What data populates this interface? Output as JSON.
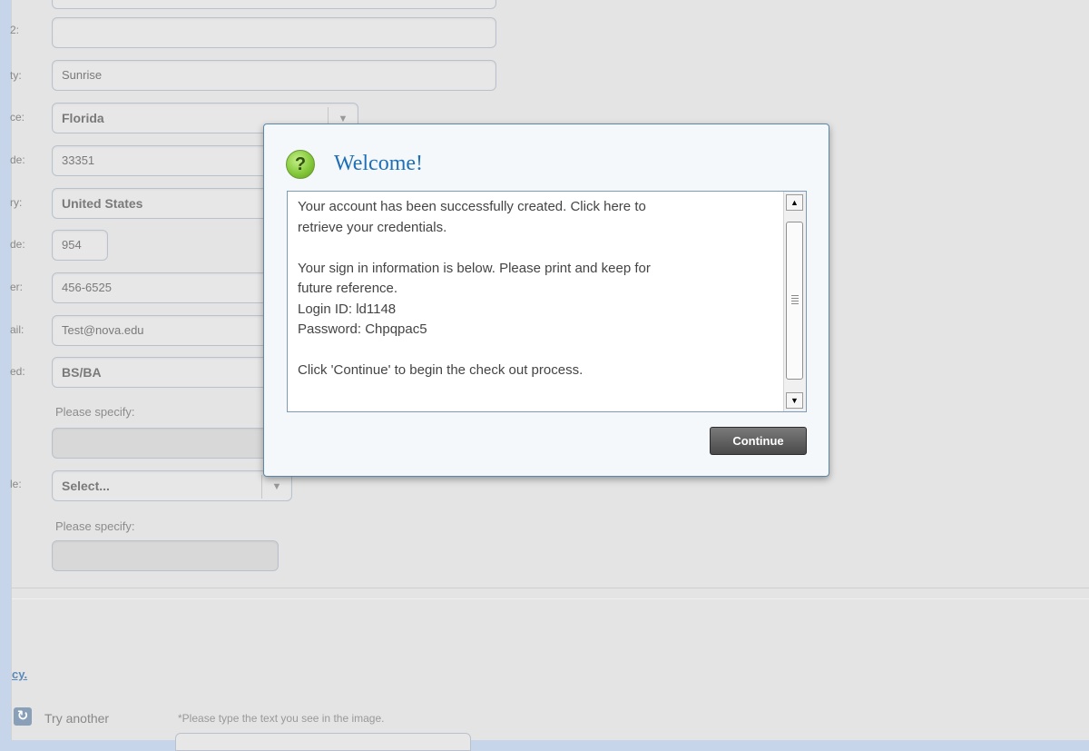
{
  "form": {
    "labels": [
      "2:",
      "ty:",
      "ce:",
      "de:",
      "ry:",
      "de:",
      "er:",
      "ail:",
      "ed:",
      "le:"
    ],
    "city": "Sunrise",
    "state": "Florida",
    "zip": "33351",
    "country": "United States",
    "area_code": "954",
    "phone": "456-6525",
    "email": "Test@nova.edu",
    "degree": "BS/BA",
    "please_specify": "Please specify:",
    "role_select": "Select...",
    "please_specify_2": "Please specify:",
    "select_arrow": "▼"
  },
  "footer": {
    "policy_link": "cy.",
    "try_another": "Try another",
    "captcha_hint": "*Please type the text you see in the image."
  },
  "modal": {
    "icon_glyph": "?",
    "title": "Welcome!",
    "lines": [
      "Your account has been successfully created. Click here to",
      "retrieve your credentials.",
      "Your sign in information is below. Please print and keep for",
      "future reference.",
      "Login ID: ld1148",
      "Password: Chpqpac5",
      "Click 'Continue' to begin the check out process."
    ],
    "continue_label": "Continue",
    "scroll_up": "▲",
    "scroll_down": "▼"
  }
}
